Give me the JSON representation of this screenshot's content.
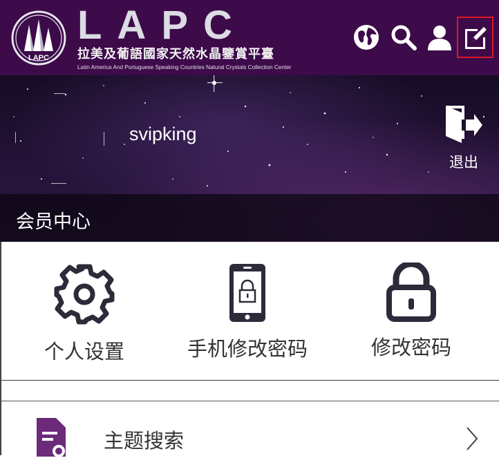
{
  "header": {
    "brand": "LAPC",
    "badge_text": "LAPC",
    "brand_cn": "拉美及葡語國家天然水晶鑒賞平臺",
    "brand_en": "Latin America And Portuguese Speaking Countries Natural Crystals Collection Center",
    "icons": [
      "globe-icon",
      "search-icon",
      "user-icon",
      "edit-icon"
    ],
    "background_color": "#3d0a4a",
    "highlight_color": "#e0182a"
  },
  "banner": {
    "username": "svipking",
    "logout_label": "退出",
    "section_title": "会员中心"
  },
  "features": [
    {
      "label": "个人设置",
      "icon": "gear-icon"
    },
    {
      "label": "手机修改密码",
      "icon": "phone-lock-icon"
    },
    {
      "label": "修改密码",
      "icon": "padlock-icon"
    }
  ],
  "menu": [
    {
      "label": "主题搜索",
      "icon": "document-search-icon",
      "accent": "#6b2a7a"
    }
  ]
}
